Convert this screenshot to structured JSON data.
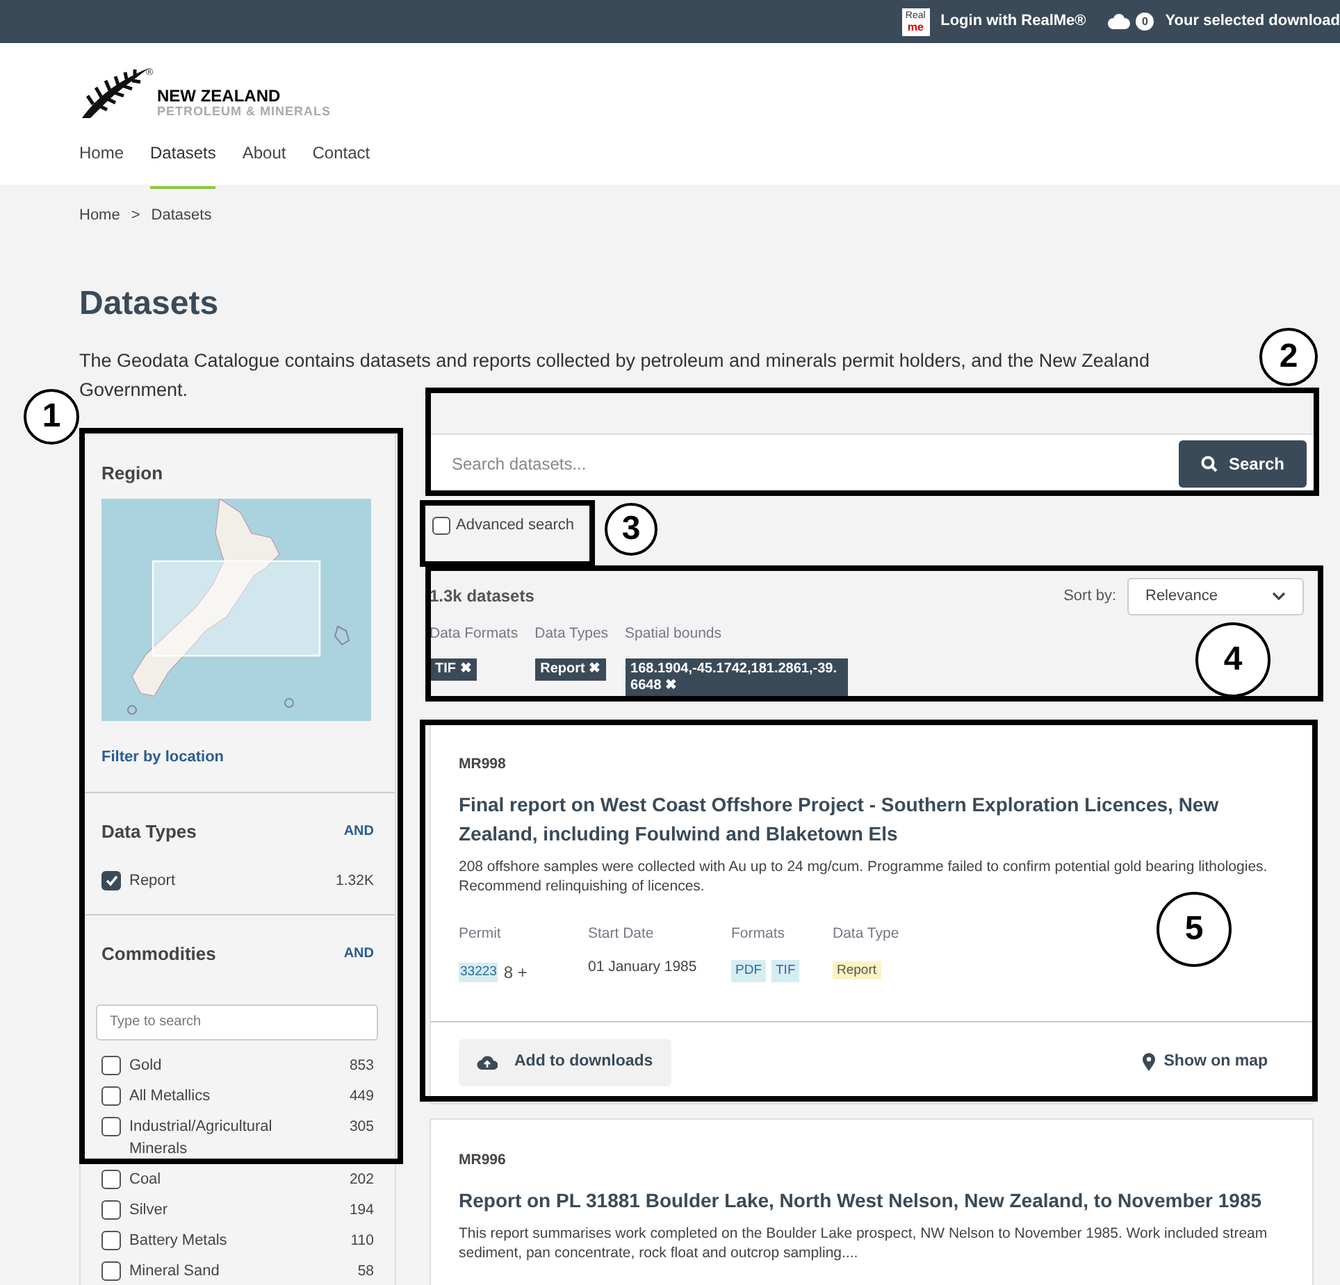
{
  "top_bar": {
    "login": "Login with RealMe®",
    "realme_badge": {
      "line1": "Real",
      "line2": "me"
    },
    "downloads_count": "0",
    "downloads": "Your selected download"
  },
  "logo": {
    "title": "NEW ZEALAND",
    "subtitle": "PETROLEUM & MINERALS",
    "mark": "®"
  },
  "nav": [
    {
      "label": "Home",
      "selected": false
    },
    {
      "label": "Datasets",
      "selected": true
    },
    {
      "label": "About",
      "selected": false
    },
    {
      "label": "Contact",
      "selected": false
    }
  ],
  "breadcrumb": [
    {
      "label": "Home"
    },
    {
      "label": "Datasets"
    }
  ],
  "breadcrumb_separator": ">",
  "page_title": "Datasets",
  "intro": "The Geodata Catalogue contains datasets and reports collected by petroleum and minerals permit holders, and the New Zealand Government.",
  "sidebar": {
    "region": {
      "title": "Region",
      "filter_link": "Filter by location"
    },
    "facets": [
      {
        "title": "Data Types",
        "operator": "AND",
        "items": [
          {
            "label": "Report",
            "count": "1.32K",
            "checked": true
          }
        ]
      },
      {
        "title": "Commodities",
        "operator": "AND",
        "search_placeholder": "Type to search",
        "items": [
          {
            "label": "Gold",
            "count": "853",
            "checked": false
          },
          {
            "label": "All Metallics",
            "count": "449",
            "checked": false
          },
          {
            "label": "Industrial/Agricultural Minerals",
            "count": "305",
            "checked": false
          },
          {
            "label": "Coal",
            "count": "202",
            "checked": false
          },
          {
            "label": "Silver",
            "count": "194",
            "checked": false
          },
          {
            "label": "Battery Metals",
            "count": "110",
            "checked": false
          },
          {
            "label": "Mineral Sand",
            "count": "58",
            "checked": false
          }
        ]
      }
    ]
  },
  "search": {
    "placeholder": "Search datasets...",
    "button": "Search"
  },
  "advanced_search": {
    "label": "Advanced search",
    "checked": false
  },
  "results": {
    "count": "1.3k datasets",
    "sort_label": "Sort by:",
    "sort_value": "Relevance",
    "filters": [
      {
        "group": "Data Formats",
        "value": "TIF"
      },
      {
        "group": "Data Types",
        "value": "Report"
      },
      {
        "group": "Spatial bounds",
        "value": "168.1904,-45.1742,181.2861,-39.6648"
      }
    ],
    "remove_symbol": "✖"
  },
  "datasets": [
    {
      "id": "MR998",
      "title": "Final report on West Coast Offshore Project - Southern Exploration Licences, New Zealand, including Foulwind and Blaketown Els",
      "description": "208 offshore samples were collected with Au up to 24 mg/cum. Programme failed to confirm potential gold bearing lithologies. Recommend relinquishing of licences.",
      "meta_labels": [
        "Permit",
        "Start Date",
        "Formats",
        "Data Type"
      ],
      "permit": "33223",
      "permit_more": "8 +",
      "start_date": "01 January 1985",
      "formats": [
        "PDF",
        "TIF"
      ],
      "data_type": "Report",
      "add_button": "Add to downloads",
      "map_link": "Show on map"
    },
    {
      "id": "MR996",
      "title": "Report on PL 31881 Boulder Lake, North West Nelson, New Zealand, to November 1985",
      "description": "This report summarises work completed on the Boulder Lake prospect, NW Nelson to November 1985. Work included stream sediment, pan concentrate, rock float and outcrop sampling...."
    }
  ],
  "callouts": [
    {
      "number": "1"
    },
    {
      "number": "2"
    },
    {
      "number": "3"
    },
    {
      "number": "4"
    },
    {
      "number": "5"
    }
  ]
}
